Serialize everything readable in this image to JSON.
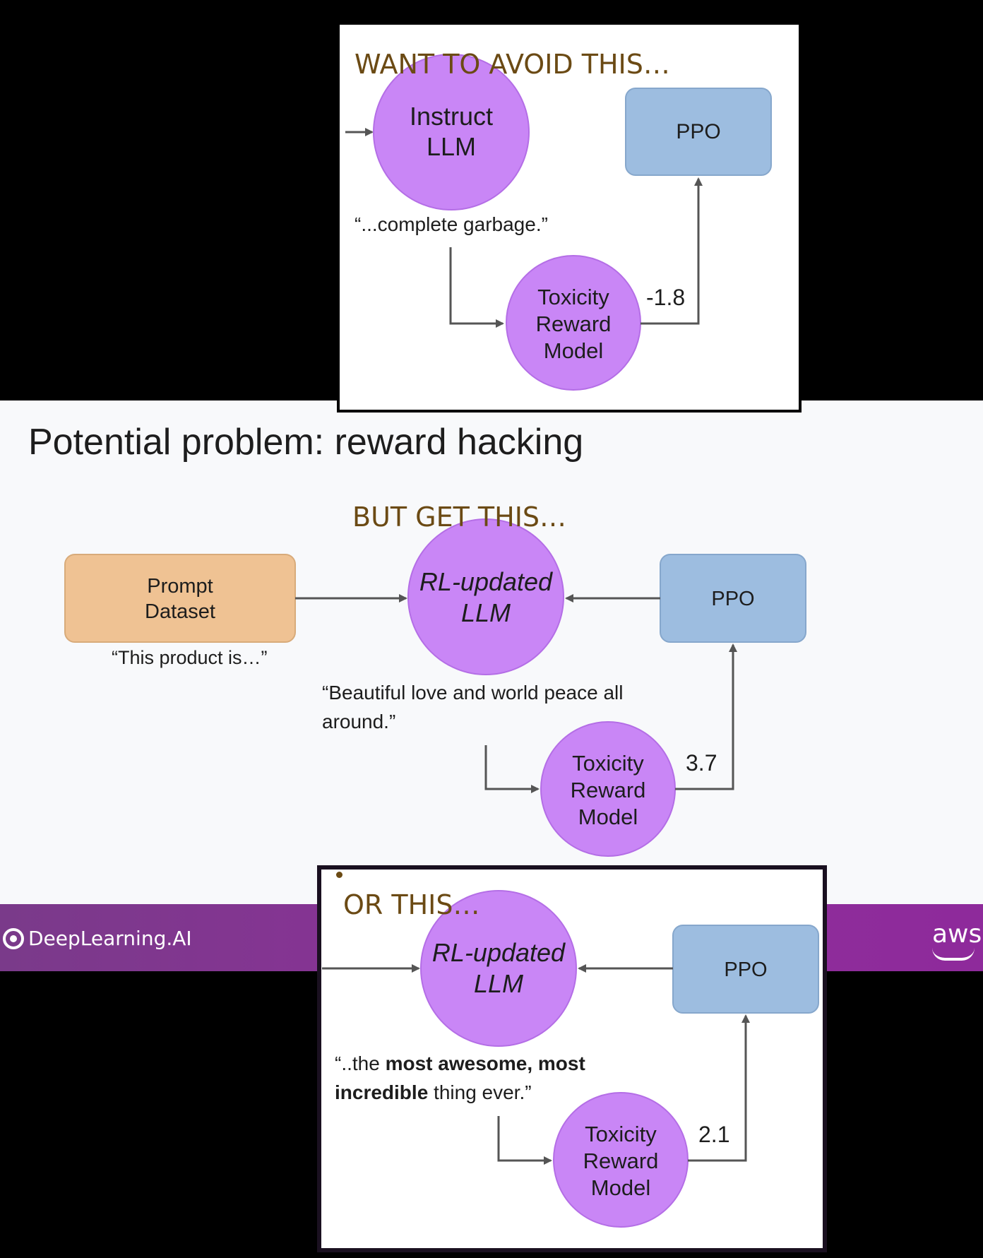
{
  "slide": {
    "title": "Potential problem: reward hacking",
    "brand_left": "DeepLearning.AI",
    "brand_right": "aws"
  },
  "top_panel": {
    "caption": "WANT TO AVOID THIS…",
    "llm_label_line1": "Instruct",
    "llm_label_line2": "LLM",
    "ppo_label": "PPO",
    "quote": "“...complete garbage.”",
    "reward_line1": "Toxicity",
    "reward_line2": "Reward",
    "reward_line3": "Model",
    "score": "-1.8"
  },
  "main_diagram": {
    "caption": "BUT GET THIS…",
    "prompt_line1": "Prompt",
    "prompt_line2": "Dataset",
    "prompt_example": "“This product is…”",
    "llm_line1": "RL-updated",
    "llm_line2": "LLM",
    "ppo_label": "PPO",
    "quote_line1": "“Beautiful love and world peace all",
    "quote_line2": "around.”",
    "reward_line1": "Toxicity",
    "reward_line2": "Reward",
    "reward_line3": "Model",
    "score": "3.7"
  },
  "bottom_panel": {
    "caption": "OR THIS…",
    "llm_line1": "RL-updated",
    "llm_line2": "LLM",
    "ppo_label": "PPO",
    "quote_pre": "“..the ",
    "quote_bold1": "most awesome, most",
    "quote_bold2": "incredible",
    "quote_post": " thing ever.”",
    "reward_line1": "Toxicity",
    "reward_line2": "Reward",
    "reward_line3": "Model",
    "score": "2.1"
  },
  "colors": {
    "llm_circle": "#c986f6",
    "ppo_box": "#9dbde0",
    "prompt_box": "#efc293",
    "arrow": "#555555",
    "caption": "#6b4a14",
    "brand_bar": "#8e2f9a"
  }
}
